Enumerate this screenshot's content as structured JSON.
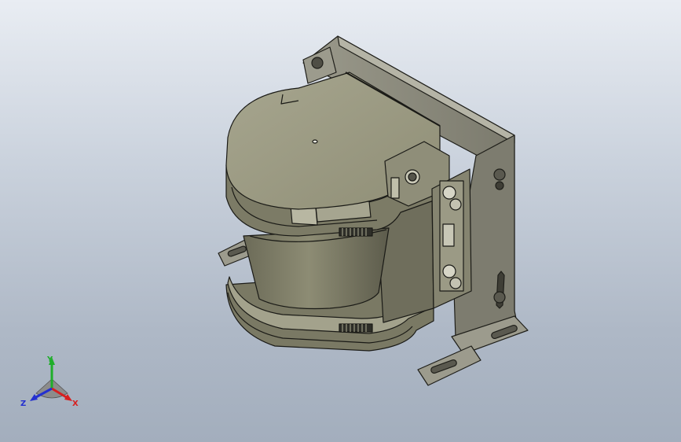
{
  "triad": {
    "x_label": "X",
    "y_label": "Y",
    "z_label": "Z",
    "x_color": "#d62020",
    "y_color": "#1fae2a",
    "z_color": "#2430d0"
  },
  "model": {
    "body_color": "#8c8a72",
    "dark_color": "#4a4a3e",
    "bracket_color": "#8a8a7c"
  }
}
